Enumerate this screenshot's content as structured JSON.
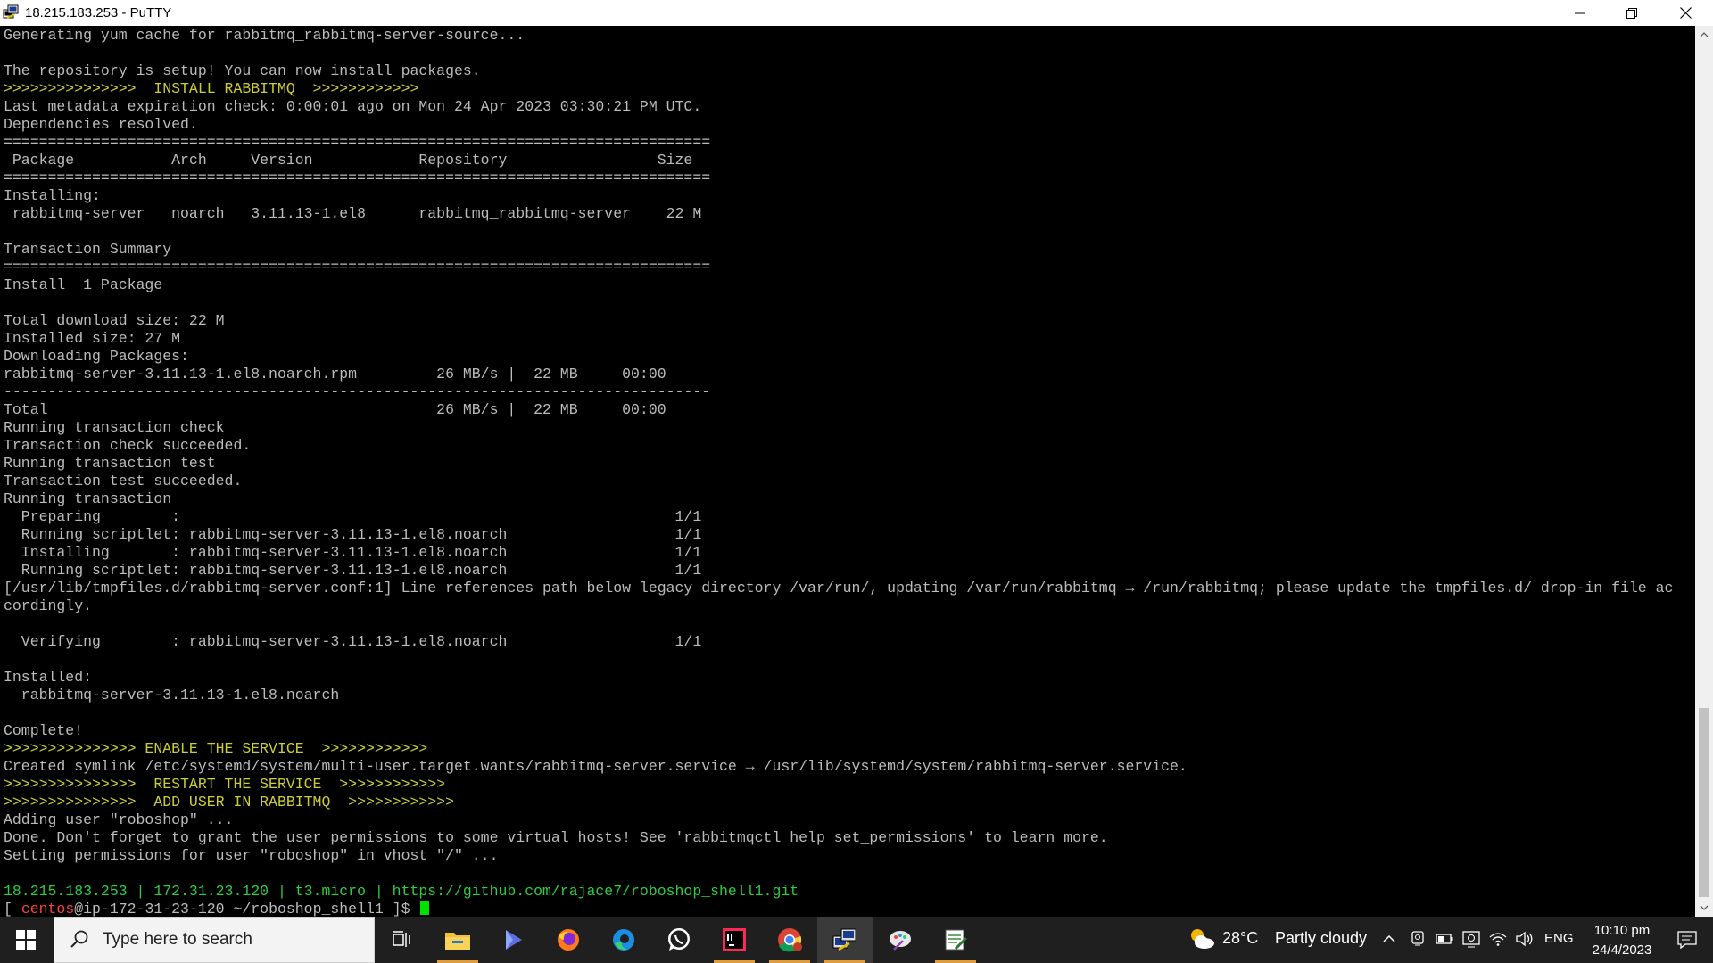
{
  "window": {
    "title": "18.215.183.253 - PuTTY",
    "icon": "putty-icon",
    "controls": [
      "minimize-icon",
      "restore-icon",
      "close-icon"
    ]
  },
  "terminal": {
    "lines": [
      {
        "text": "Generating yum cache for rabbitmq_rabbitmq-server-source...",
        "color": "default"
      },
      {
        "text": "",
        "color": "default"
      },
      {
        "text": "The repository is setup! You can now install packages.",
        "color": "default"
      },
      {
        "text": ">>>>>>>>>>>>>>>  INSTALL RABBITMQ  >>>>>>>>>>>>",
        "color": "yellow"
      },
      {
        "text": "Last metadata expiration check: 0:00:01 ago on Mon 24 Apr 2023 03:30:21 PM UTC.",
        "color": "default"
      },
      {
        "text": "Dependencies resolved.",
        "color": "default"
      },
      {
        "text": "================================================================================",
        "color": "default"
      },
      {
        "text": " Package           Arch     Version            Repository                 Size",
        "color": "default"
      },
      {
        "text": "================================================================================",
        "color": "default"
      },
      {
        "text": "Installing:",
        "color": "default"
      },
      {
        "text": " rabbitmq-server   noarch   3.11.13-1.el8      rabbitmq_rabbitmq-server    22 M",
        "color": "default"
      },
      {
        "text": "",
        "color": "default"
      },
      {
        "text": "Transaction Summary",
        "color": "default"
      },
      {
        "text": "================================================================================",
        "color": "default"
      },
      {
        "text": "Install  1 Package",
        "color": "default"
      },
      {
        "text": "",
        "color": "default"
      },
      {
        "text": "Total download size: 22 M",
        "color": "default"
      },
      {
        "text": "Installed size: 27 M",
        "color": "default"
      },
      {
        "text": "Downloading Packages:",
        "color": "default"
      },
      {
        "text": "rabbitmq-server-3.11.13-1.el8.noarch.rpm         26 MB/s |  22 MB     00:00",
        "color": "default"
      },
      {
        "text": "--------------------------------------------------------------------------------",
        "color": "default"
      },
      {
        "text": "Total                                            26 MB/s |  22 MB     00:00",
        "color": "default"
      },
      {
        "text": "Running transaction check",
        "color": "default"
      },
      {
        "text": "Transaction check succeeded.",
        "color": "default"
      },
      {
        "text": "Running transaction test",
        "color": "default"
      },
      {
        "text": "Transaction test succeeded.",
        "color": "default"
      },
      {
        "text": "Running transaction",
        "color": "default"
      },
      {
        "text": "  Preparing        :                                                        1/1",
        "color": "default"
      },
      {
        "text": "  Running scriptlet: rabbitmq-server-3.11.13-1.el8.noarch                   1/1",
        "color": "default"
      },
      {
        "text": "  Installing       : rabbitmq-server-3.11.13-1.el8.noarch                   1/1",
        "color": "default"
      },
      {
        "text": "  Running scriptlet: rabbitmq-server-3.11.13-1.el8.noarch                   1/1",
        "color": "default"
      },
      {
        "text": "[/usr/lib/tmpfiles.d/rabbitmq-server.conf:1] Line references path below legacy directory /var/run/, updating /var/run/rabbitmq → /run/rabbitmq; please update the tmpfiles.d/ drop-in file ac",
        "color": "default"
      },
      {
        "text": "cordingly.",
        "color": "default"
      },
      {
        "text": "",
        "color": "default"
      },
      {
        "text": "  Verifying        : rabbitmq-server-3.11.13-1.el8.noarch                   1/1",
        "color": "default"
      },
      {
        "text": "",
        "color": "default"
      },
      {
        "text": "Installed:",
        "color": "default"
      },
      {
        "text": "  rabbitmq-server-3.11.13-1.el8.noarch",
        "color": "default"
      },
      {
        "text": "",
        "color": "default"
      },
      {
        "text": "Complete!",
        "color": "default"
      },
      {
        "text": ">>>>>>>>>>>>>>> ENABLE THE SERVICE  >>>>>>>>>>>>",
        "color": "yellow"
      },
      {
        "text": "Created symlink /etc/systemd/system/multi-user.target.wants/rabbitmq-server.service → /usr/lib/systemd/system/rabbitmq-server.service.",
        "color": "default"
      },
      {
        "text": ">>>>>>>>>>>>>>>  RESTART THE SERVICE  >>>>>>>>>>>>",
        "color": "yellow"
      },
      {
        "text": ">>>>>>>>>>>>>>>  ADD USER IN RABBITMQ  >>>>>>>>>>>>",
        "color": "yellow"
      },
      {
        "text": "Adding user \"roboshop\" ...",
        "color": "default"
      },
      {
        "text": "Done. Don't forget to grant the user permissions to some virtual hosts! See 'rabbitmqctl help set_permissions' to learn more.",
        "color": "default"
      },
      {
        "text": "Setting permissions for user \"roboshop\" in vhost \"/\" ...",
        "color": "default"
      },
      {
        "text": "",
        "color": "default"
      },
      {
        "text": "18.215.183.253 | 172.31.23.120 | t3.micro | https://github.com/rajace7/roboshop_shell1.git",
        "color": "green"
      }
    ],
    "prompt": {
      "open": "[ ",
      "user": "centos",
      "host_path": "@ip-172-31-23-120 ~/roboshop_shell1 ]$ "
    },
    "colors": {
      "default": "#bbbbbb",
      "yellow": "#cbcd38",
      "green": "#2ecc40",
      "red": "#ff4040",
      "cursor": "#00e000"
    }
  },
  "taskbar": {
    "search_placeholder": "Type here to search",
    "apps": [
      {
        "name": "task-view-icon"
      },
      {
        "name": "file-explorer-icon"
      },
      {
        "name": "app-blue-icon"
      },
      {
        "name": "firefox-icon"
      },
      {
        "name": "edge-icon"
      },
      {
        "name": "whatsapp-icon"
      },
      {
        "name": "intellij-icon"
      },
      {
        "name": "chrome-icon"
      },
      {
        "name": "putty-icon",
        "active": true
      },
      {
        "name": "paint-icon"
      },
      {
        "name": "notepad-icon"
      }
    ],
    "weather": {
      "temp": "28°C",
      "desc": "Partly cloudy"
    },
    "language": "ENG",
    "time": "10:10 pm",
    "date": "24/4/2023"
  }
}
